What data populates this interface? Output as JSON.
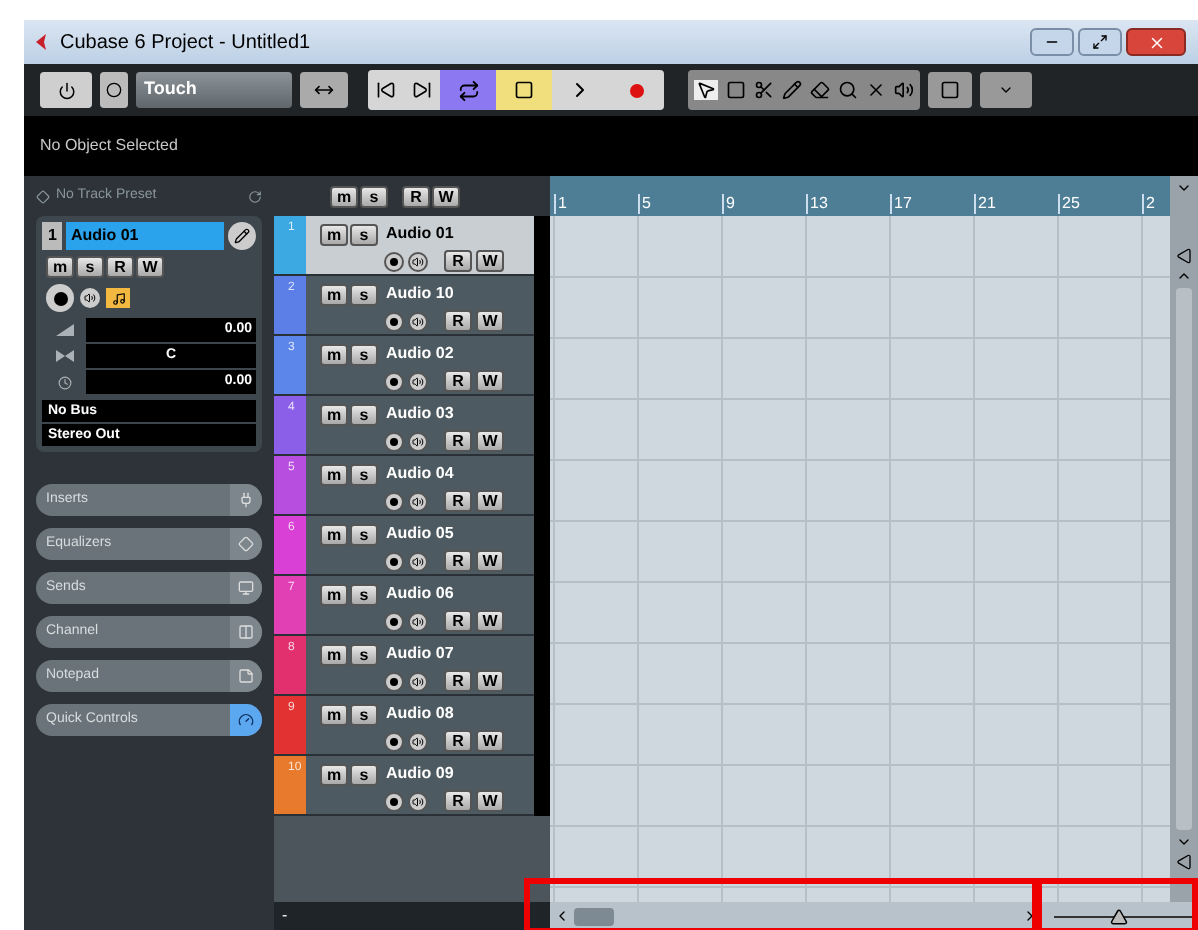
{
  "window": {
    "title": "Cubase 6 Project - Untitled1"
  },
  "toolbar": {
    "automation_mode": "Touch",
    "cycle_on": true,
    "stop_on": true
  },
  "info_line": "No Object Selected",
  "inspector": {
    "preset": "No Track Preset",
    "track_number": "1",
    "track_name": "Audio 01",
    "buttons": [
      "m",
      "s",
      "R",
      "W"
    ],
    "volume": "0.00",
    "pan": "C",
    "delay": "0.00",
    "routing": [
      "No Bus",
      "Stereo Out"
    ],
    "sections": [
      {
        "label": "Inserts",
        "selected": false
      },
      {
        "label": "Equalizers",
        "selected": false
      },
      {
        "label": "Sends",
        "selected": false
      },
      {
        "label": "Channel",
        "selected": false
      },
      {
        "label": "Notepad",
        "selected": false
      },
      {
        "label": "Quick Controls",
        "selected": true
      }
    ]
  },
  "track_list": {
    "header_buttons": [
      "m",
      "s",
      "R",
      "W"
    ],
    "footer": "-",
    "tracks": [
      {
        "number": "1",
        "name": "Audio 01",
        "color": "#3ca9e2",
        "selected": true,
        "buttons": [
          "m",
          "s",
          "R",
          "W"
        ]
      },
      {
        "number": "2",
        "name": "Audio 10",
        "color": "#5b7fe6",
        "selected": false,
        "buttons": [
          "m",
          "s",
          "R",
          "W"
        ]
      },
      {
        "number": "3",
        "name": "Audio 02",
        "color": "#5d86ea",
        "selected": false,
        "buttons": [
          "m",
          "s",
          "R",
          "W"
        ]
      },
      {
        "number": "4",
        "name": "Audio 03",
        "color": "#8c5fe8",
        "selected": false,
        "buttons": [
          "m",
          "s",
          "R",
          "W"
        ]
      },
      {
        "number": "5",
        "name": "Audio 04",
        "color": "#b84ee0",
        "selected": false,
        "buttons": [
          "m",
          "s",
          "R",
          "W"
        ]
      },
      {
        "number": "6",
        "name": "Audio 05",
        "color": "#d840d6",
        "selected": false,
        "buttons": [
          "m",
          "s",
          "R",
          "W"
        ]
      },
      {
        "number": "7",
        "name": "Audio 06",
        "color": "#e040b4",
        "selected": false,
        "buttons": [
          "m",
          "s",
          "R",
          "W"
        ]
      },
      {
        "number": "8",
        "name": "Audio 07",
        "color": "#e2306e",
        "selected": false,
        "buttons": [
          "m",
          "s",
          "R",
          "W"
        ]
      },
      {
        "number": "9",
        "name": "Audio 08",
        "color": "#e23232",
        "selected": false,
        "buttons": [
          "m",
          "s",
          "R",
          "W"
        ]
      },
      {
        "number": "10",
        "name": "Audio 09",
        "color": "#e87a2e",
        "selected": false,
        "buttons": [
          "m",
          "s",
          "R",
          "W"
        ]
      }
    ]
  },
  "ruler": {
    "bars": [
      "1",
      "5",
      "9",
      "13",
      "17",
      "21",
      "25",
      "2"
    ]
  },
  "horizontal_zoom": {
    "level": 0.45
  }
}
